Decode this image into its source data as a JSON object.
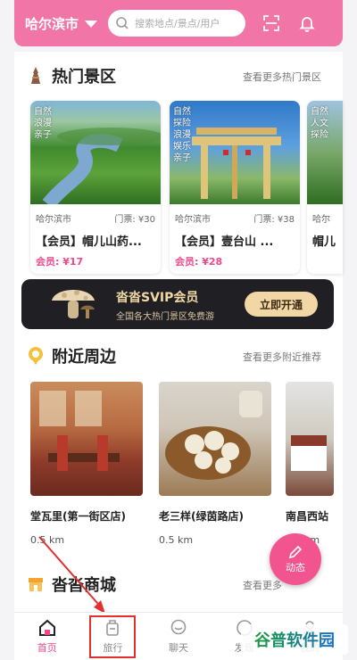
{
  "header": {
    "city": "哈尔滨市",
    "search_placeholder": "搜索地点/景点/用户"
  },
  "hot": {
    "title": "热门景区",
    "more": "查看更多热门景区",
    "cards": [
      {
        "tags": [
          "自然",
          "浪漫",
          "亲子"
        ],
        "city": "哈尔滨市",
        "price": "门票: ¥30",
        "name": "【会员】帽儿山药...",
        "vip": "会员: ¥17"
      },
      {
        "tags": [
          "自然",
          "探险",
          "浪漫",
          "娱乐",
          "亲子"
        ],
        "city": "哈尔滨市",
        "price": "门票: ¥38",
        "name": "【会员】壹台山 ...",
        "vip": "会员: ¥28"
      },
      {
        "tags": [
          "自然",
          "人文",
          "探险"
        ],
        "city": "哈尔",
        "price": "",
        "name": "帽儿",
        "vip": ""
      }
    ]
  },
  "svip": {
    "title": "沓沓SVIP会员",
    "subtitle": "全国各大热门景区免费游",
    "button": "立即开通"
  },
  "nearby": {
    "title": "附近周边",
    "more": "查看更多附近推荐",
    "items": [
      {
        "name": "堂瓦里(第一街区店)",
        "distance": "0.5 km"
      },
      {
        "name": "老三样(绿茵路店)",
        "distance": "0.5 km"
      },
      {
        "name": "南昌西站",
        "distance": "9.7 km"
      }
    ]
  },
  "mall": {
    "title": "沓沓商城",
    "more": "查看更多"
  },
  "fab": {
    "label": "动态"
  },
  "tabs": [
    {
      "label": "首页",
      "icon": "home-icon",
      "active": true
    },
    {
      "label": "旅行",
      "icon": "luggage-icon",
      "active": false
    },
    {
      "label": "聊天",
      "icon": "chat-icon",
      "active": false
    },
    {
      "label": "发现",
      "icon": "discover-icon",
      "active": false
    },
    {
      "label": "我的",
      "icon": "profile-icon",
      "active": false
    }
  ],
  "watermark": {
    "text": "谷普软件园"
  },
  "colors": {
    "brand": "#f275a8",
    "accent": "#f2478a",
    "annotation": "#e23030"
  }
}
